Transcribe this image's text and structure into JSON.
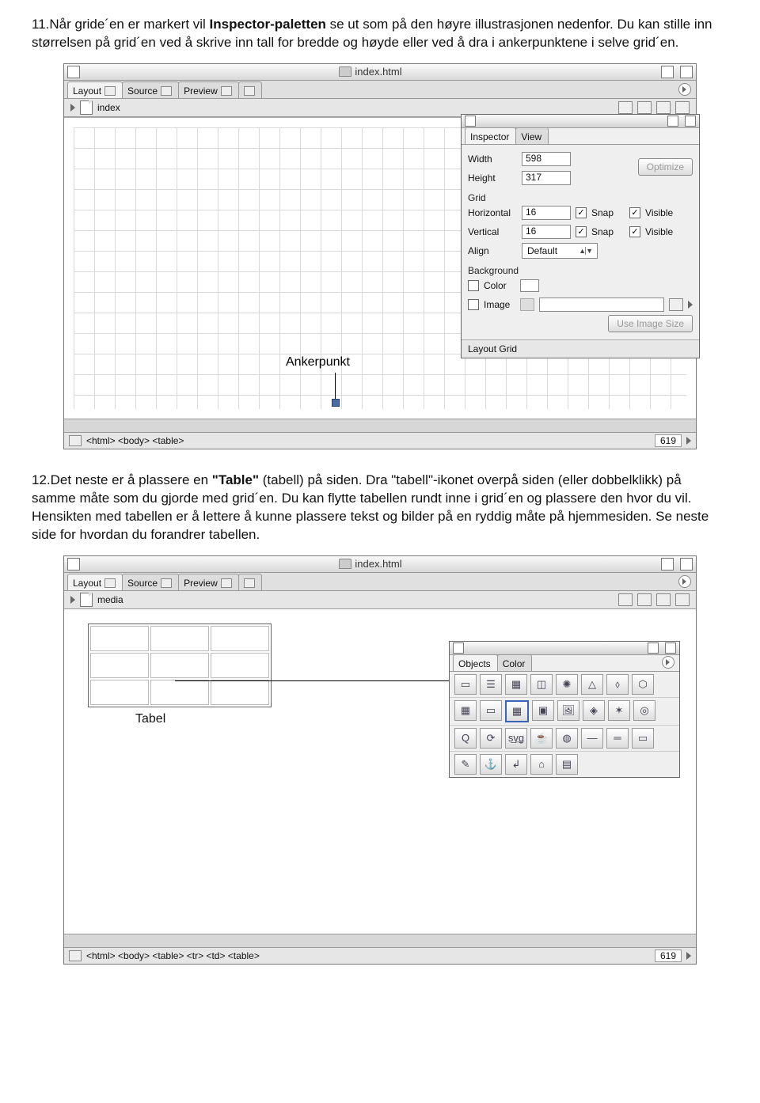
{
  "step11": {
    "prefix": "11.",
    "t1": "Når gride´en er markert vil ",
    "bold": "Inspector-paletten",
    "t2": " se ut som på den høyre illustrasjonen nedenfor. Du kan stille inn størrelsen på grid´en ved å skrive inn tall for bredde og høyde eller ved å dra i ankerpunktene i selve grid´en."
  },
  "fig1": {
    "windowTitle": "index.html",
    "tabs": {
      "layout": "Layout",
      "source": "Source",
      "preview": "Preview"
    },
    "breadcrumb": "index",
    "ankerLabel": "Ankerpunkt",
    "status": "<html> <body> <table>",
    "statusNum": "619",
    "inspector": {
      "tabInspector": "Inspector",
      "tabView": "View",
      "widthLabel": "Width",
      "widthVal": "598",
      "heightLabel": "Height",
      "heightVal": "317",
      "optimize": "Optimize",
      "sectGrid": "Grid",
      "horizLabel": "Horizontal",
      "horizVal": "16",
      "vertLabel": "Vertical",
      "vertVal": "16",
      "snap": "Snap",
      "visible": "Visible",
      "alignLabel": "Align",
      "alignVal": "Default",
      "sectBg": "Background",
      "colorLabel": "Color",
      "imageLabel": "Image",
      "useImg": "Use Image Size",
      "footer": "Layout Grid"
    }
  },
  "step12": {
    "prefix": "12.",
    "t1": "Det neste er å plassere en ",
    "bold": "\"Table\"",
    "t2": " (tabell) på siden. Dra \"tabell\"-ikonet overpå siden (eller dobbelklikk) på samme måte som du gjorde med grid´en. Du kan flytte tabellen rundt inne i grid´en og plassere den hvor du vil. Hensikten med tabellen er å lettere å kunne plassere tekst og bilder på en ryddig måte på hjemmesiden. Se neste side for hvordan du forandrer tabellen."
  },
  "fig2": {
    "windowTitle": "index.html",
    "tabs": {
      "layout": "Layout",
      "source": "Source",
      "preview": "Preview"
    },
    "breadcrumb": "media",
    "tableLabel": "Tabel",
    "status": "<html> <body> <table> <tr> <td> <table>",
    "statusNum": "619",
    "objects": {
      "tabObjects": "Objects",
      "tabColor": "Color"
    }
  }
}
